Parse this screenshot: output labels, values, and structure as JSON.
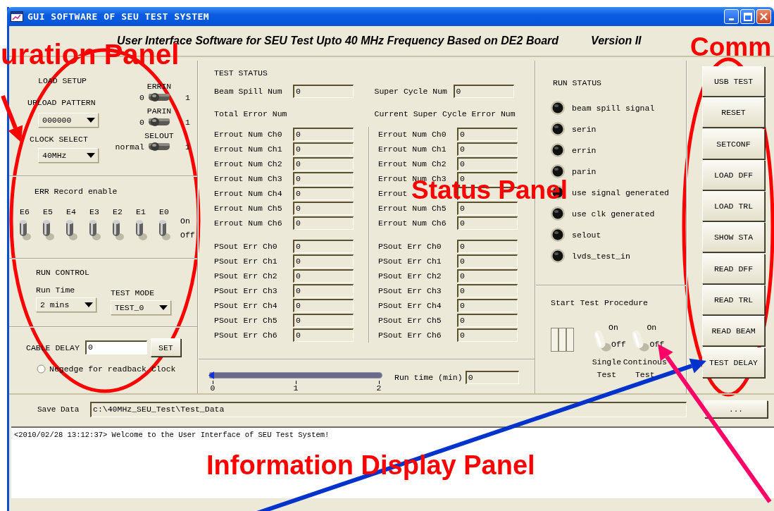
{
  "window": {
    "title": "GUI SOFTWARE OF SEU TEST SYSTEM"
  },
  "header": {
    "subtitle": "User Interface Software for SEU Test Upto 40 MHz Frequency Based on DE2 Board",
    "version": "Version II"
  },
  "configuration_panel": {
    "load_setup": {
      "title": "LOAD SETUP",
      "upload_pattern": {
        "label": "UPLOAD PATTERN",
        "value": "000000"
      },
      "clock_select": {
        "label": "CLOCK SELECT",
        "value": "40MHz"
      },
      "switches": [
        {
          "label": "ERRIN",
          "off_label": "0",
          "on_label": "1",
          "on": false
        },
        {
          "label": "PARIN",
          "off_label": "0",
          "on_label": "1",
          "on": false
        },
        {
          "label": "SELOUT",
          "off_label": "normal",
          "on_label": "1",
          "on": false
        }
      ]
    },
    "err_record": {
      "title": "ERR Record enable",
      "on_label": "On",
      "off_label": "Off",
      "toggles": [
        {
          "label": "E6",
          "on": true
        },
        {
          "label": "E5",
          "on": true
        },
        {
          "label": "E4",
          "on": true
        },
        {
          "label": "E3",
          "on": true
        },
        {
          "label": "E2",
          "on": true
        },
        {
          "label": "E1",
          "on": true
        },
        {
          "label": "E0",
          "on": true
        }
      ]
    },
    "run_control": {
      "title": "RUN CONTROL",
      "run_time": {
        "label": "Run Time",
        "value": "2 mins"
      },
      "test_mode": {
        "label": "TEST MODE",
        "value": "TEST_0"
      }
    },
    "cable_delay": {
      "label": "CABLE DELAY",
      "value": "0",
      "button": "SET",
      "radio": {
        "label": "Negedge for readback Clock",
        "selected": false
      }
    }
  },
  "status_panel": {
    "title": "TEST STATUS",
    "beam_spill": {
      "label": "Beam Spill Num",
      "value": "0"
    },
    "super_cycle": {
      "label": "Super Cycle Num",
      "value": "0"
    },
    "total_heading": "Total Error Num",
    "current_heading": "Current Super Cycle Error Num",
    "total_errout": [
      {
        "label": "Errout Num Ch0",
        "value": "0"
      },
      {
        "label": "Errout Num Ch1",
        "value": "0"
      },
      {
        "label": "Errout Num Ch2",
        "value": "0"
      },
      {
        "label": "Errout Num Ch3",
        "value": "0"
      },
      {
        "label": "Errout Num Ch4",
        "value": "0"
      },
      {
        "label": "Errout Num Ch5",
        "value": "0"
      },
      {
        "label": "Errout Num Ch6",
        "value": "0"
      }
    ],
    "total_psout": [
      {
        "label": "PSout Err Ch0",
        "value": "0"
      },
      {
        "label": "PSout Err Ch1",
        "value": "0"
      },
      {
        "label": "PSout Err Ch2",
        "value": "0"
      },
      {
        "label": "PSout Err Ch3",
        "value": "0"
      },
      {
        "label": "PSout Err Ch4",
        "value": "0"
      },
      {
        "label": "PSout Err Ch5",
        "value": "0"
      },
      {
        "label": "PSout Err Ch6",
        "value": "0"
      }
    ],
    "current_errout": [
      {
        "label": "Errout Num Ch0",
        "value": "0"
      },
      {
        "label": "Errout Num Ch1",
        "value": "0"
      },
      {
        "label": "Errout Num Ch2",
        "value": "0"
      },
      {
        "label": "Errout Num Ch3",
        "value": "0"
      },
      {
        "label": "Errout"
      },
      {
        "label": "Errout Num Ch5",
        "value": "0"
      },
      {
        "label": "Errout Num Ch6",
        "value": "0"
      }
    ],
    "current_psout": [
      {
        "label": "PSout Err Ch0",
        "value": "0"
      },
      {
        "label": "PSout Err Ch1",
        "value": "0"
      },
      {
        "label": "PSout Err Ch2",
        "value": "0"
      },
      {
        "label": "PSout Err Ch3",
        "value": "0"
      },
      {
        "label": "PSout Err Ch4",
        "value": "0"
      },
      {
        "label": "PSout Err Ch5",
        "value": "0"
      },
      {
        "label": "PSout Err Ch6",
        "value": "0"
      }
    ],
    "run_slider": {
      "level": 0,
      "ticks": [
        "0",
        "1",
        "2"
      ]
    },
    "run_time": {
      "label": "Run time (min)",
      "value": "0"
    }
  },
  "run_status": {
    "title": "RUN STATUS",
    "indicators": [
      {
        "label": "beam spill signal",
        "lit": false
      },
      {
        "label": "serin",
        "lit": false
      },
      {
        "label": "errin",
        "lit": false
      },
      {
        "label": "parin",
        "lit": false
      },
      {
        "label": "use signal generated",
        "lit": false
      },
      {
        "label": "use clk generated",
        "lit": false
      },
      {
        "label": "selout",
        "lit": false
      },
      {
        "label": "lvds_test_in",
        "lit": false
      }
    ]
  },
  "start_test": {
    "title": "Start Test Procedure",
    "switches": [
      {
        "on_label": "On",
        "off_label": "Off",
        "label_lines": [
          "Single",
          "Test"
        ],
        "on": false
      },
      {
        "on_label": "On",
        "off_label": "Off",
        "label_lines": [
          "Continous",
          "Test"
        ],
        "on": false
      }
    ]
  },
  "commands": [
    "USB TEST",
    "RESET",
    "SETCONF",
    "LOAD DFF",
    "LOAD TRL",
    "SHOW STA",
    "READ DFF",
    "READ TRL",
    "READ BEAM",
    "TEST DELAY"
  ],
  "save_data": {
    "label": "Save Data",
    "value": "c:\\40MHz_SEU_Test\\Test_Data",
    "browse_button": "..."
  },
  "log": [
    "<2010/02/28 13:12:37> Welcome to the User Interface of SEU Test System!"
  ],
  "annotations": [
    {
      "kind": "label",
      "text": "uration Panel",
      "color": "#ff0000"
    },
    {
      "kind": "label",
      "text": "Comm",
      "color": "#ff0000"
    },
    {
      "kind": "label",
      "text": "Status Panel",
      "color": "#ff0000"
    },
    {
      "kind": "label",
      "text": "Information Display Panel",
      "color": "#ff0000"
    },
    {
      "kind": "ellipse",
      "color": "#ff0000"
    },
    {
      "kind": "ellipse",
      "color": "#ff0000"
    },
    {
      "kind": "arrow",
      "color": "#ff0000"
    },
    {
      "kind": "arrow",
      "color": "#0033cc"
    },
    {
      "kind": "arrow",
      "color": "#ff0066"
    }
  ]
}
